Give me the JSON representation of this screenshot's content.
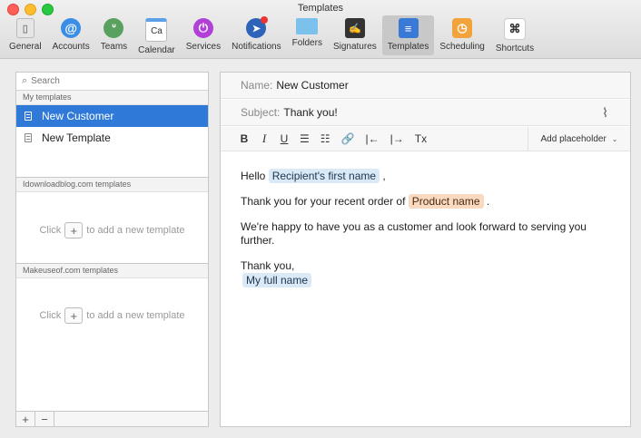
{
  "window": {
    "title": "Templates"
  },
  "toolbar": {
    "items": [
      {
        "label": "General",
        "icon": "general-icon",
        "glyph": "▯"
      },
      {
        "label": "Accounts",
        "icon": "accounts-icon",
        "glyph": "@"
      },
      {
        "label": "Teams",
        "icon": "teams-icon",
        "glyph": "ᐡ"
      },
      {
        "label": "Calendar",
        "icon": "calendar-icon",
        "glyph": "Ca"
      },
      {
        "label": "Services",
        "icon": "services-icon",
        "glyph": "⏻"
      },
      {
        "label": "Notifications",
        "icon": "notifications-icon",
        "glyph": "➤"
      },
      {
        "label": "Folders",
        "icon": "folders-icon",
        "glyph": ""
      },
      {
        "label": "Signatures",
        "icon": "signatures-icon",
        "glyph": "✍"
      },
      {
        "label": "Templates",
        "icon": "templates-icon",
        "glyph": "≡"
      },
      {
        "label": "Scheduling",
        "icon": "scheduling-icon",
        "glyph": "◷"
      },
      {
        "label": "Shortcuts",
        "icon": "shortcuts-icon",
        "glyph": "⌘"
      }
    ]
  },
  "sidebar": {
    "search_placeholder": "Search",
    "sections": [
      {
        "header": "My templates",
        "items": [
          {
            "label": "New Customer",
            "selected": true
          },
          {
            "label": "New Template",
            "selected": false
          }
        ]
      },
      {
        "header": "Idownloadblog.com templates",
        "hint_prefix": "Click",
        "hint_suffix": "to add a new template"
      },
      {
        "header": "Makeuseof.com templates",
        "hint_prefix": "Click",
        "hint_suffix": "to add a new template"
      }
    ],
    "footer": {
      "add": "+",
      "remove": "−"
    }
  },
  "editor": {
    "name_label": "Name:",
    "name_value": "New Customer",
    "subject_label": "Subject:",
    "subject_value": "Thank you!",
    "format_buttons": [
      "B",
      "I",
      "U",
      "☰",
      "☷",
      "🔗",
      "|←",
      "|→",
      "Tx"
    ],
    "add_placeholder_label": "Add placeholder",
    "body": {
      "line1_prefix": "Hello",
      "line1_token": "Recipient's first name",
      "line1_suffix": ",",
      "line2_prefix": "Thank you for your recent order of",
      "line2_token": "Product name",
      "line2_suffix": ".",
      "line3": "We're happy to have you as a customer and look forward to serving you further.",
      "line4": "Thank you,",
      "line5_token": "My full name"
    }
  },
  "colors": {
    "selection": "#2f7ad8",
    "token_blue": "#dbe9f7",
    "token_orange": "#f9d9bf"
  }
}
